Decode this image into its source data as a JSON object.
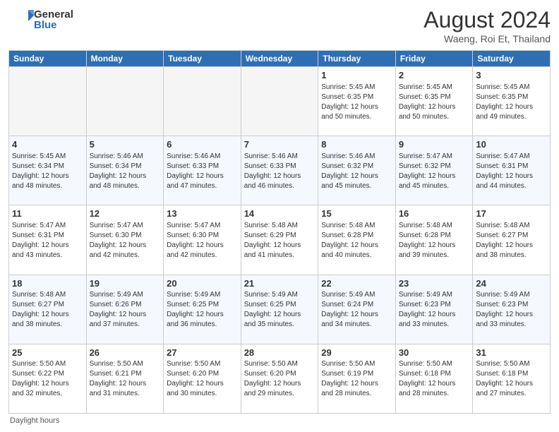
{
  "logo": {
    "general": "General",
    "blue": "Blue"
  },
  "title": "August 2024",
  "location": "Waeng, Roi Et, Thailand",
  "days_of_week": [
    "Sunday",
    "Monday",
    "Tuesday",
    "Wednesday",
    "Thursday",
    "Friday",
    "Saturday"
  ],
  "footer": "Daylight hours",
  "weeks": [
    [
      {
        "day": "",
        "info": ""
      },
      {
        "day": "",
        "info": ""
      },
      {
        "day": "",
        "info": ""
      },
      {
        "day": "",
        "info": ""
      },
      {
        "day": "1",
        "info": "Sunrise: 5:45 AM\nSunset: 6:35 PM\nDaylight: 12 hours\nand 50 minutes."
      },
      {
        "day": "2",
        "info": "Sunrise: 5:45 AM\nSunset: 6:35 PM\nDaylight: 12 hours\nand 50 minutes."
      },
      {
        "day": "3",
        "info": "Sunrise: 5:45 AM\nSunset: 6:35 PM\nDaylight: 12 hours\nand 49 minutes."
      }
    ],
    [
      {
        "day": "4",
        "info": "Sunrise: 5:45 AM\nSunset: 6:34 PM\nDaylight: 12 hours\nand 48 minutes."
      },
      {
        "day": "5",
        "info": "Sunrise: 5:46 AM\nSunset: 6:34 PM\nDaylight: 12 hours\nand 48 minutes."
      },
      {
        "day": "6",
        "info": "Sunrise: 5:46 AM\nSunset: 6:33 PM\nDaylight: 12 hours\nand 47 minutes."
      },
      {
        "day": "7",
        "info": "Sunrise: 5:46 AM\nSunset: 6:33 PM\nDaylight: 12 hours\nand 46 minutes."
      },
      {
        "day": "8",
        "info": "Sunrise: 5:46 AM\nSunset: 6:32 PM\nDaylight: 12 hours\nand 45 minutes."
      },
      {
        "day": "9",
        "info": "Sunrise: 5:47 AM\nSunset: 6:32 PM\nDaylight: 12 hours\nand 45 minutes."
      },
      {
        "day": "10",
        "info": "Sunrise: 5:47 AM\nSunset: 6:31 PM\nDaylight: 12 hours\nand 44 minutes."
      }
    ],
    [
      {
        "day": "11",
        "info": "Sunrise: 5:47 AM\nSunset: 6:31 PM\nDaylight: 12 hours\nand 43 minutes."
      },
      {
        "day": "12",
        "info": "Sunrise: 5:47 AM\nSunset: 6:30 PM\nDaylight: 12 hours\nand 42 minutes."
      },
      {
        "day": "13",
        "info": "Sunrise: 5:47 AM\nSunset: 6:30 PM\nDaylight: 12 hours\nand 42 minutes."
      },
      {
        "day": "14",
        "info": "Sunrise: 5:48 AM\nSunset: 6:29 PM\nDaylight: 12 hours\nand 41 minutes."
      },
      {
        "day": "15",
        "info": "Sunrise: 5:48 AM\nSunset: 6:28 PM\nDaylight: 12 hours\nand 40 minutes."
      },
      {
        "day": "16",
        "info": "Sunrise: 5:48 AM\nSunset: 6:28 PM\nDaylight: 12 hours\nand 39 minutes."
      },
      {
        "day": "17",
        "info": "Sunrise: 5:48 AM\nSunset: 6:27 PM\nDaylight: 12 hours\nand 38 minutes."
      }
    ],
    [
      {
        "day": "18",
        "info": "Sunrise: 5:48 AM\nSunset: 6:27 PM\nDaylight: 12 hours\nand 38 minutes."
      },
      {
        "day": "19",
        "info": "Sunrise: 5:49 AM\nSunset: 6:26 PM\nDaylight: 12 hours\nand 37 minutes."
      },
      {
        "day": "20",
        "info": "Sunrise: 5:49 AM\nSunset: 6:25 PM\nDaylight: 12 hours\nand 36 minutes."
      },
      {
        "day": "21",
        "info": "Sunrise: 5:49 AM\nSunset: 6:25 PM\nDaylight: 12 hours\nand 35 minutes."
      },
      {
        "day": "22",
        "info": "Sunrise: 5:49 AM\nSunset: 6:24 PM\nDaylight: 12 hours\nand 34 minutes."
      },
      {
        "day": "23",
        "info": "Sunrise: 5:49 AM\nSunset: 6:23 PM\nDaylight: 12 hours\nand 33 minutes."
      },
      {
        "day": "24",
        "info": "Sunrise: 5:49 AM\nSunset: 6:23 PM\nDaylight: 12 hours\nand 33 minutes."
      }
    ],
    [
      {
        "day": "25",
        "info": "Sunrise: 5:50 AM\nSunset: 6:22 PM\nDaylight: 12 hours\nand 32 minutes."
      },
      {
        "day": "26",
        "info": "Sunrise: 5:50 AM\nSunset: 6:21 PM\nDaylight: 12 hours\nand 31 minutes."
      },
      {
        "day": "27",
        "info": "Sunrise: 5:50 AM\nSunset: 6:20 PM\nDaylight: 12 hours\nand 30 minutes."
      },
      {
        "day": "28",
        "info": "Sunrise: 5:50 AM\nSunset: 6:20 PM\nDaylight: 12 hours\nand 29 minutes."
      },
      {
        "day": "29",
        "info": "Sunrise: 5:50 AM\nSunset: 6:19 PM\nDaylight: 12 hours\nand 28 minutes."
      },
      {
        "day": "30",
        "info": "Sunrise: 5:50 AM\nSunset: 6:18 PM\nDaylight: 12 hours\nand 28 minutes."
      },
      {
        "day": "31",
        "info": "Sunrise: 5:50 AM\nSunset: 6:18 PM\nDaylight: 12 hours\nand 27 minutes."
      }
    ]
  ]
}
